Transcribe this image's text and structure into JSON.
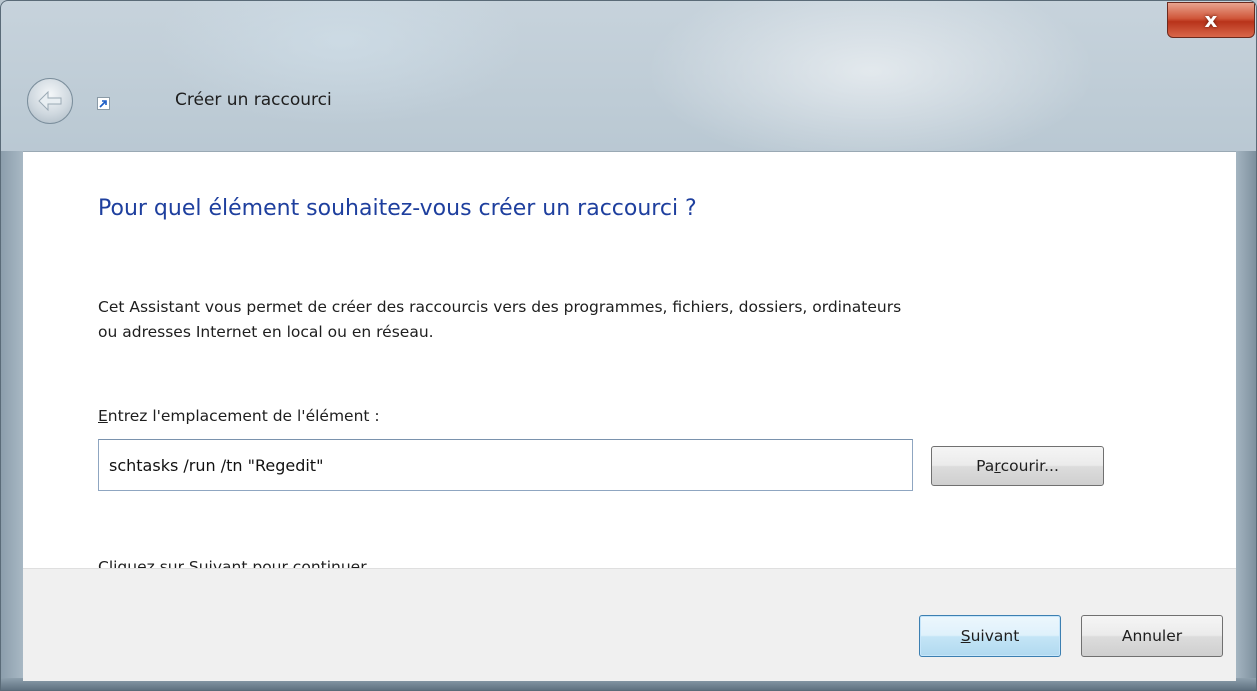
{
  "window": {
    "title": "Créer un raccourci",
    "close_label": "x",
    "icons": {
      "back": "back-arrow-icon",
      "shortcut": "shortcut-icon"
    }
  },
  "content": {
    "heading": "Pour quel élément souhaitez-vous créer un raccourci ?",
    "description_line1": "Cet Assistant vous permet de créer des raccourcis vers des programmes, fichiers, dossiers, ordinateurs",
    "description_line2": "ou adresses Internet en local ou en réseau.",
    "field_label_mnemonic": "E",
    "field_label_rest": "ntrez l'emplacement de l'élément :",
    "location_value": "schtasks /run /tn \"Regedit\"",
    "browse_pre": "Pa",
    "browse_mnemonic": "r",
    "browse_post": "courir...",
    "hint": "Cliquez sur Suivant pour continuer."
  },
  "footer": {
    "next_mnemonic": "S",
    "next_rest": "uivant",
    "cancel_label": "Annuler"
  },
  "colors": {
    "heading": "#1e3f9e",
    "close_button": "#c8442a",
    "primary_button_border": "#3c7fb1"
  }
}
